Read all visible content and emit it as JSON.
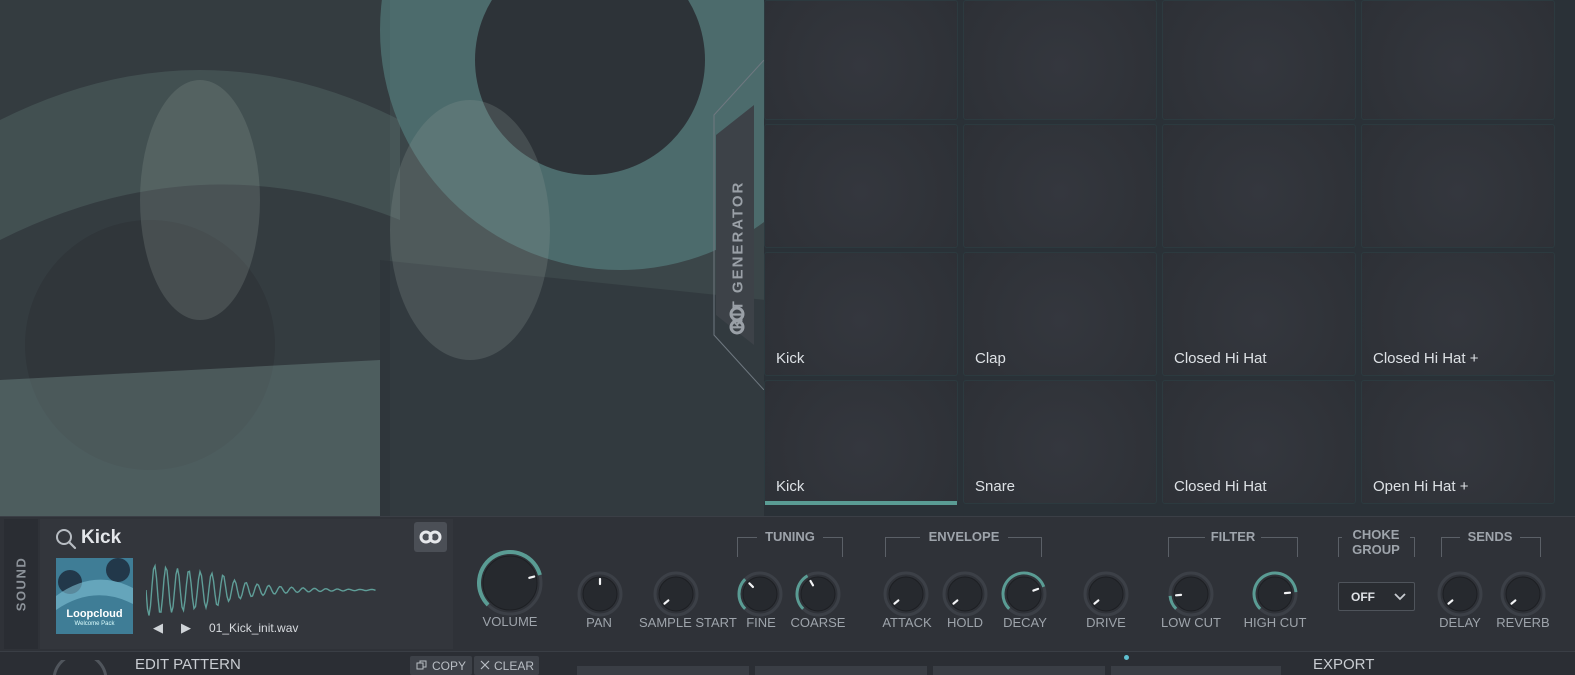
{
  "kit_generator": {
    "label": "KIT GENERATOR"
  },
  "pads": [
    {
      "label": ""
    },
    {
      "label": ""
    },
    {
      "label": ""
    },
    {
      "label": ""
    },
    {
      "label": ""
    },
    {
      "label": ""
    },
    {
      "label": ""
    },
    {
      "label": ""
    },
    {
      "label": "Kick"
    },
    {
      "label": "Clap"
    },
    {
      "label": "Closed Hi Hat"
    },
    {
      "label": "Closed Hi Hat +"
    },
    {
      "label": "Kick"
    },
    {
      "label": "Snare"
    },
    {
      "label": "Closed Hi Hat"
    },
    {
      "label": "Open Hi Hat +"
    }
  ],
  "sound": {
    "tab_label": "SOUND",
    "name": "Kick",
    "artwork_title": "Loopcloud",
    "artwork_subtitle": "Welcome Pack",
    "file_name": "01_Kick_init.wav",
    "prev_glyph": "◀",
    "next_glyph": "▶"
  },
  "groups": {
    "tuning": "TUNING",
    "envelope": "ENVELOPE",
    "filter": "FILTER",
    "choke_group": "CHOKE GROUP",
    "sends": "SENDS"
  },
  "knobs": {
    "volume": "VOLUME",
    "pan": "PAN",
    "sample_start": "SAMPLE START",
    "fine": "FINE",
    "coarse": "COARSE",
    "attack": "ATTACK",
    "hold": "HOLD",
    "decay": "DECAY",
    "drive": "DRIVE",
    "low_cut": "LOW CUT",
    "high_cut": "HIGH CUT",
    "delay": "DELAY",
    "reverb": "REVERB"
  },
  "choke": {
    "value": "OFF"
  },
  "pattern": {
    "title": "EDIT PATTERN",
    "copy_label": "COPY",
    "clear_label": "CLEAR",
    "export_label": "EXPORT"
  },
  "colors": {
    "accent": "#5a9c94",
    "background": "#2f3238",
    "text": "#cfd3d8"
  }
}
